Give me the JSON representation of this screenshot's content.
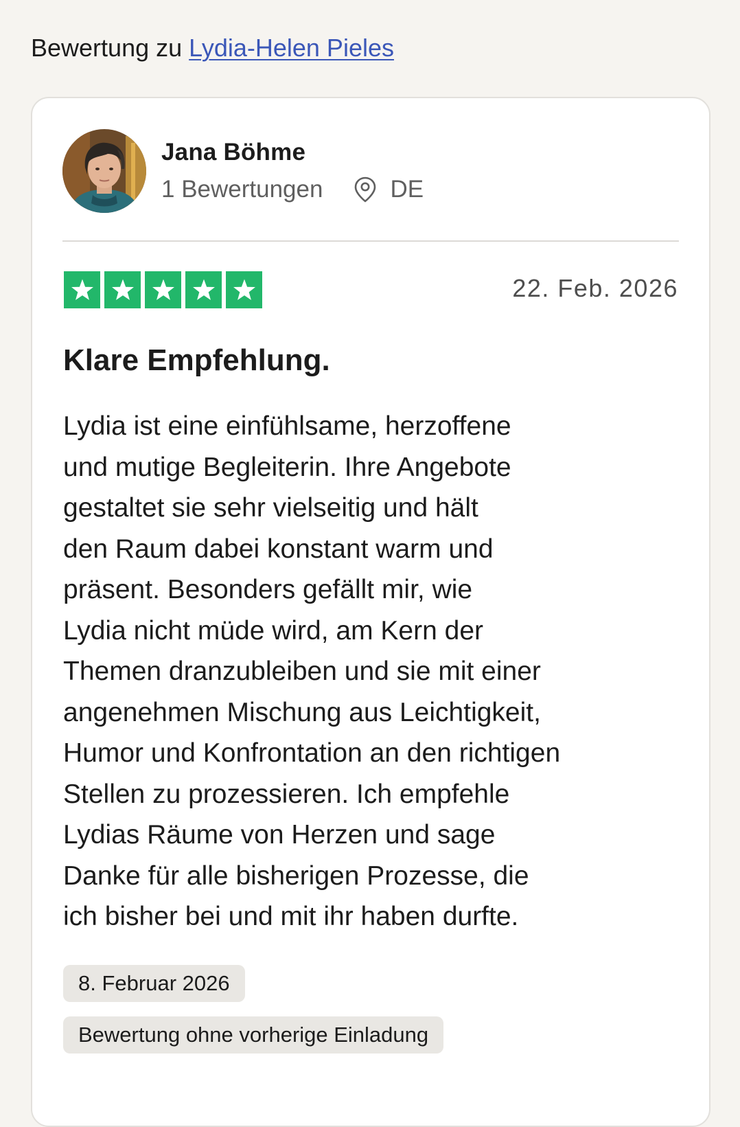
{
  "header": {
    "prefix": "Bewertung zu",
    "company_link": "Lydia-Helen Pieles"
  },
  "reviewer": {
    "name": "Jana Böhme",
    "review_count": "1 Bewertungen",
    "location_icon": "map-pin-icon",
    "country": "DE"
  },
  "review": {
    "rating": 5,
    "rating_max": 5,
    "star_color": "#22b76a",
    "date": "22. Feb. 2026",
    "title": "Klare Empfehlung.",
    "body_lines": [
      "Lydia ist eine einfühlsame, herzoffene",
      "und mutige Begleiterin. Ihre Angebote",
      "gestaltet sie sehr vielseitig und hält",
      "den Raum dabei konstant warm und",
      "präsent. Besonders gefällt mir, wie",
      "Lydia nicht müde wird, am Kern der",
      "Themen dranzubleiben und sie mit einer",
      "angenehmen Mischung aus Leichtigkeit,",
      "Humor und Konfrontation an den richtigen",
      "Stellen zu prozessieren. Ich empfehle",
      "Lydias Räume von Herzen und sage",
      "Danke für alle bisherigen Prozesse, die",
      "ich bisher bei und mit ihr haben durfte."
    ],
    "experience_date": "8. Februar 2026",
    "invitation_label": "Bewertung ohne vorherige Einladung"
  },
  "colors": {
    "link": "#3b57b8",
    "background": "#f6f4f0",
    "tag_background": "#e9e7e3"
  }
}
